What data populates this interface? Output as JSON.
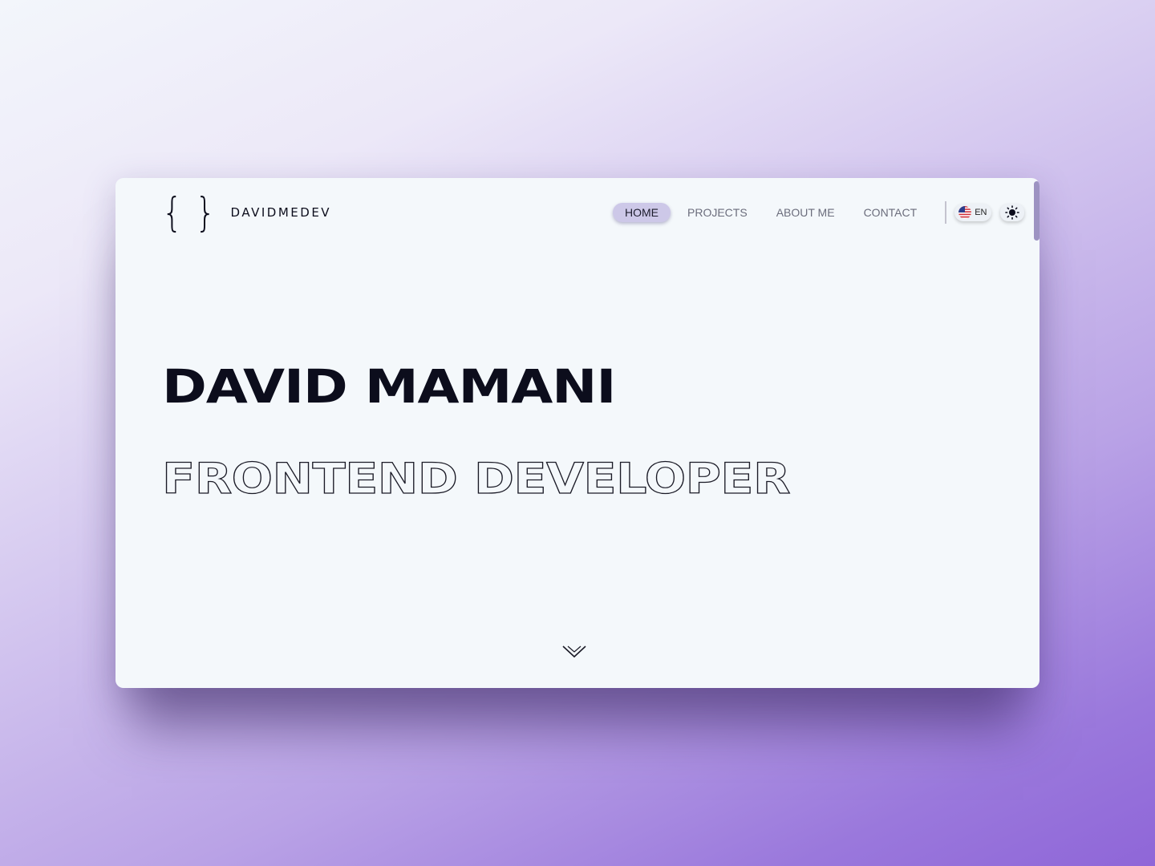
{
  "logo": {
    "brace": "{ }",
    "text": "DAVIDMEDEV"
  },
  "nav": {
    "items": [
      {
        "label": "HOME",
        "active": true
      },
      {
        "label": "PROJECTS",
        "active": false
      },
      {
        "label": "ABOUT ME",
        "active": false
      },
      {
        "label": "CONTACT",
        "active": false
      }
    ],
    "language": {
      "label": "EN",
      "flag_icon": "us-flag-icon"
    },
    "theme_icon": "sun-icon"
  },
  "hero": {
    "name": "DAVID MAMANI",
    "role": "FRONTEND DEVELOPER"
  },
  "scroll_icon": "chevron-down-icon",
  "colors": {
    "accent": "#cdc8e8",
    "text_dark": "#0c0d1c",
    "window_bg": "#f4f8fb",
    "scrollbar": "#9d93c2"
  }
}
